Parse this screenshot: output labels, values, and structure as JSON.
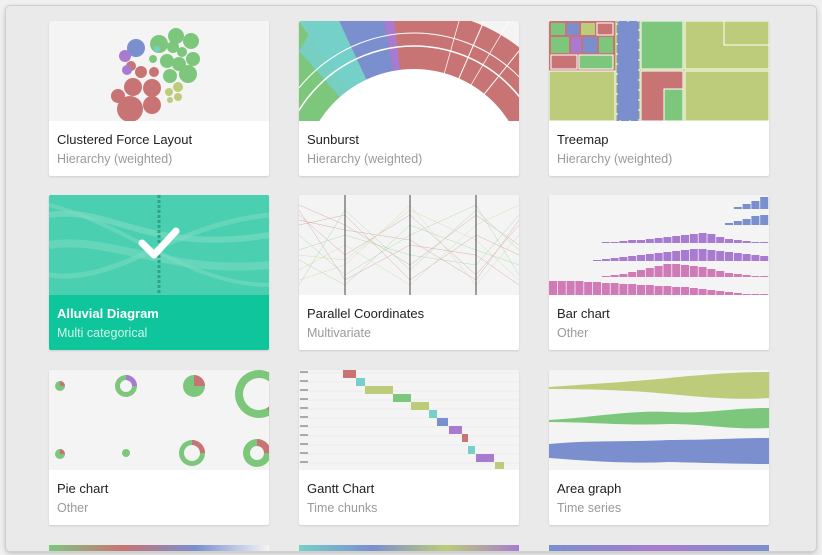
{
  "charts": [
    {
      "title": "Clustered Force Layout",
      "category": "Hierarchy (weighted)",
      "icon": "clustered-force-thumbnail"
    },
    {
      "title": "Sunburst",
      "category": "Hierarchy (weighted)",
      "icon": "sunburst-thumbnail"
    },
    {
      "title": "Treemap",
      "category": "Hierarchy (weighted)",
      "icon": "treemap-thumbnail"
    },
    {
      "title": "Alluvial Diagram",
      "category": "Multi categorical",
      "icon": "alluvial-thumbnail",
      "selected": true
    },
    {
      "title": "Parallel Coordinates",
      "category": "Multivariate",
      "icon": "parallel-coordinates-thumbnail"
    },
    {
      "title": "Bar chart",
      "category": "Other",
      "icon": "bar-chart-thumbnail"
    },
    {
      "title": "Pie chart",
      "category": "Other",
      "icon": "pie-chart-thumbnail"
    },
    {
      "title": "Gantt Chart",
      "category": "Time chunks",
      "icon": "gantt-thumbnail"
    },
    {
      "title": "Area graph",
      "category": "Time series",
      "icon": "area-graph-thumbnail"
    }
  ],
  "colors": {
    "selected": "#0fc59b",
    "red": "#c97474",
    "green": "#7dc77d",
    "blue": "#7b8fcf",
    "purple": "#a87bd0",
    "olive": "#bccc7a",
    "teal": "#76cfc9",
    "pink": "#d07ab8"
  }
}
